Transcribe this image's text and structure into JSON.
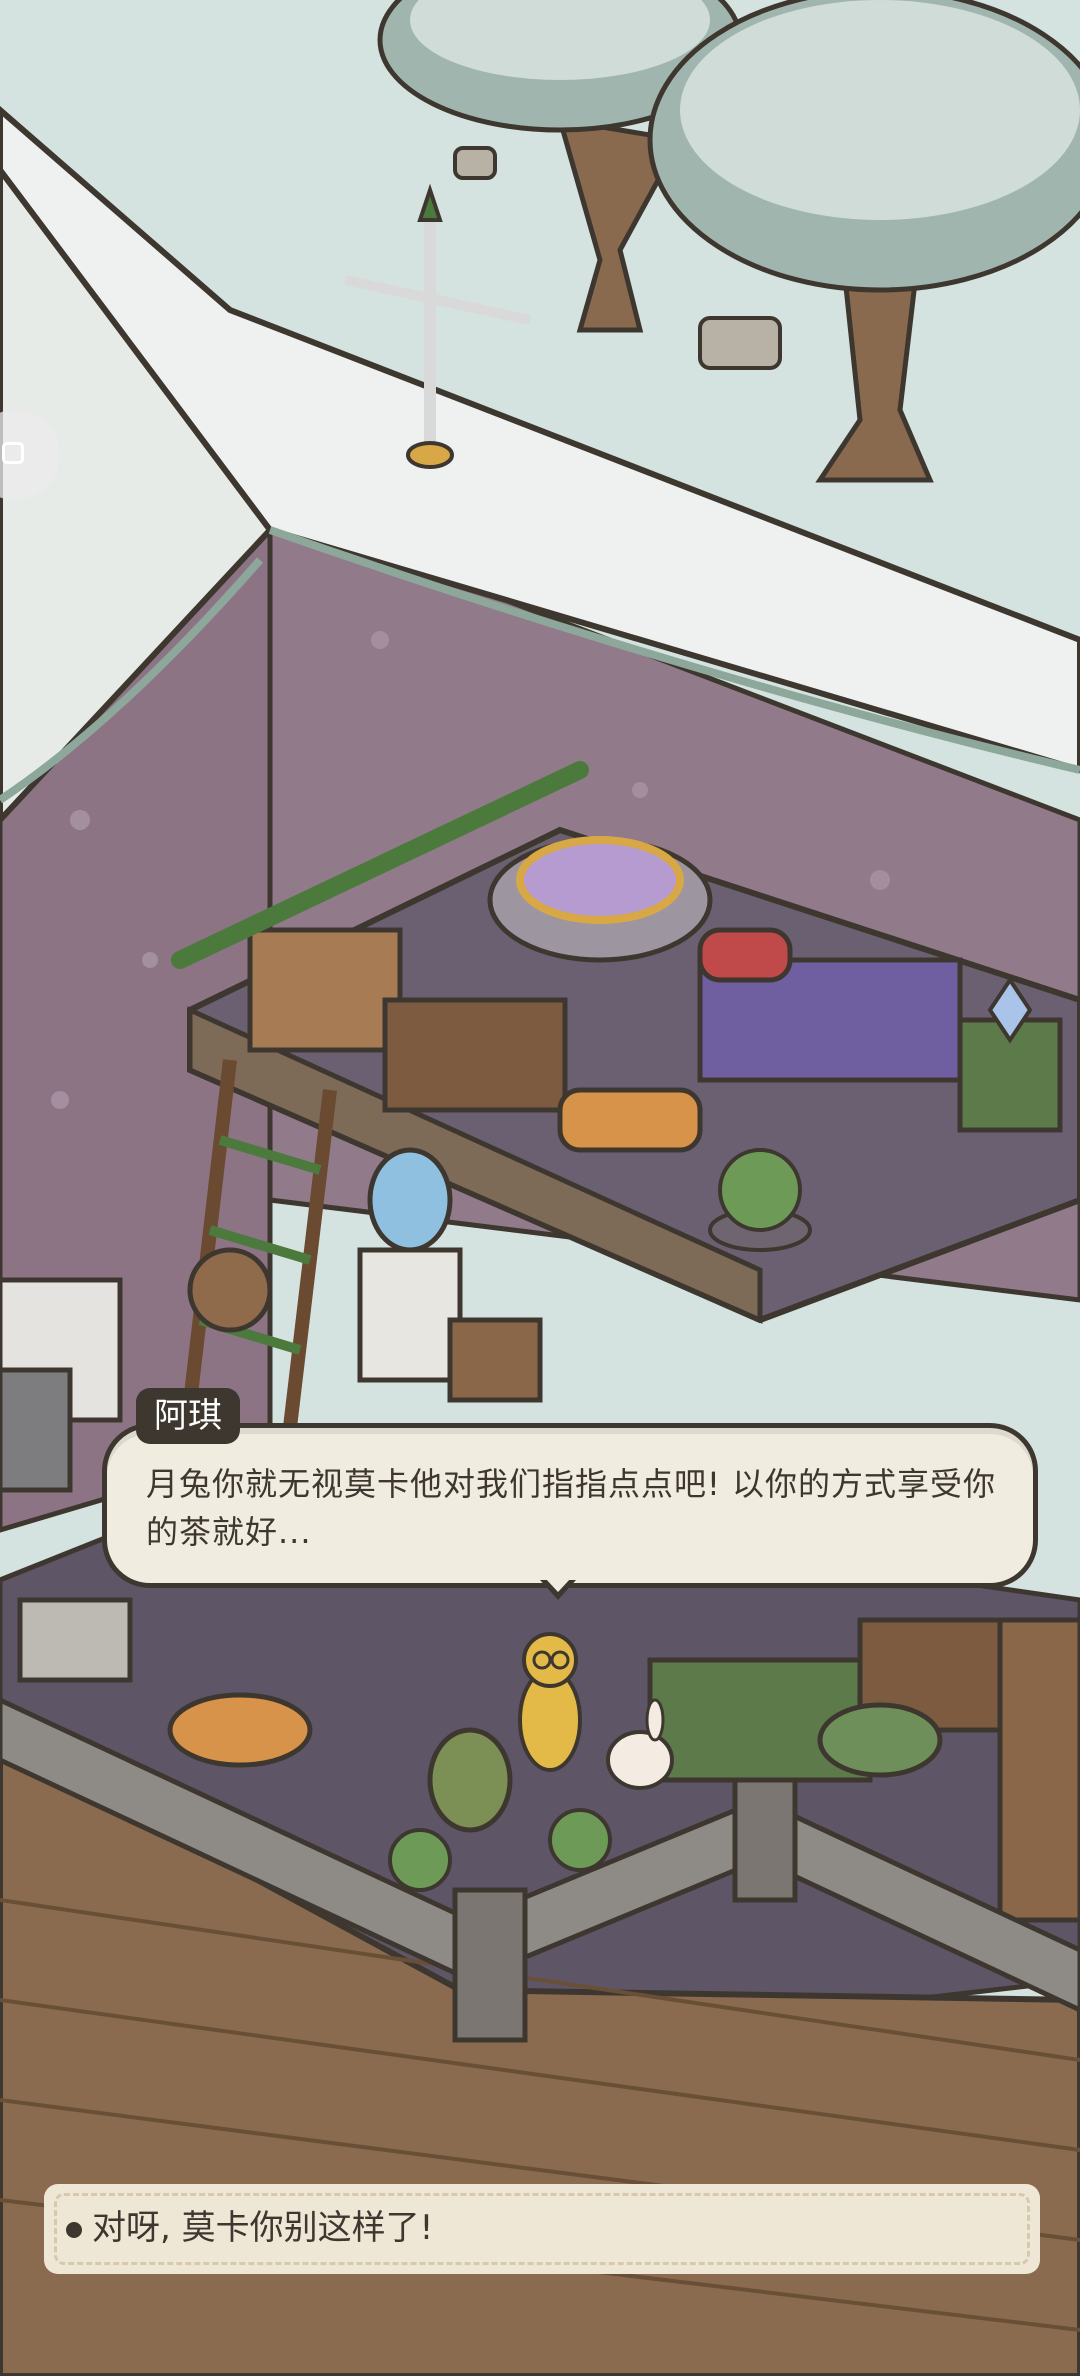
{
  "dialog": {
    "speaker": "阿琪",
    "text": "月兔你就无视莫卡他对我们指指点点吧! 以你的方式享受你的茶就好..."
  },
  "choice": {
    "text": "对呀, 莫卡你别这样了!"
  },
  "palette": {
    "snow": "#dfe6e3",
    "roof_snow": "#eef1ef",
    "wall": "#8f7786",
    "wood_deck": "#8b6b4f",
    "floor": "#5f5666",
    "dialog_bg": "#f1ece0",
    "dialog_border": "#3e3730"
  }
}
